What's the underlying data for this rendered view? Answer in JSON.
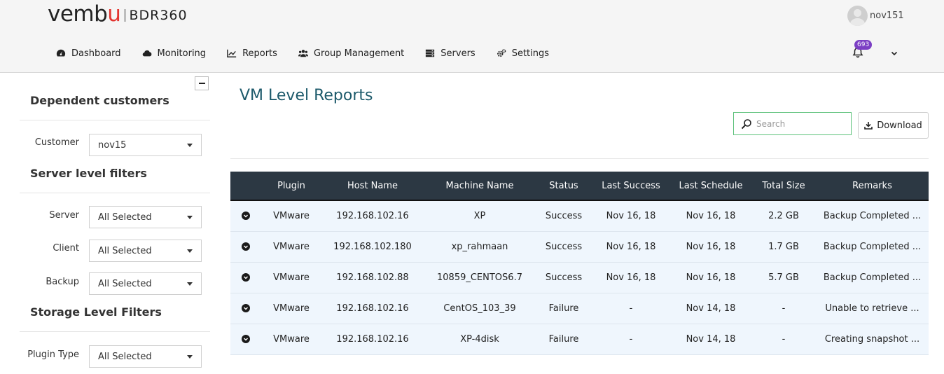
{
  "brand": {
    "word_start": "vemb",
    "word_u": "u",
    "product": "BDR360"
  },
  "user": {
    "name": "nov151"
  },
  "nav": [
    {
      "label": "Dashboard",
      "icon": "dashboard-icon"
    },
    {
      "label": "Monitoring",
      "icon": "cloud-icon"
    },
    {
      "label": "Reports",
      "icon": "line-chart-icon"
    },
    {
      "label": "Group Management",
      "icon": "users-icon"
    },
    {
      "label": "Servers",
      "icon": "server-icon"
    },
    {
      "label": "Settings",
      "icon": "cogs-icon"
    }
  ],
  "notifications": {
    "count": "693"
  },
  "sidebar": {
    "section1_title": "Dependent customers",
    "customer_label": "Customer",
    "customer_value": "nov15",
    "section2_title": "Server level filters",
    "server_label": "Server",
    "server_value": "All Selected",
    "client_label": "Client",
    "client_value": "All Selected",
    "backup_label": "Backup",
    "backup_value": "All Selected",
    "section3_title": "Storage Level Filters",
    "plugin_label": "Plugin Type",
    "plugin_value": "All Selected"
  },
  "main": {
    "title": "VM Level Reports",
    "search_placeholder": "Search",
    "download_label": "Download"
  },
  "table": {
    "headers": [
      "",
      "Plugin",
      "Host Name",
      "Machine Name",
      "Status",
      "Last Success",
      "Last Schedule",
      "Total Size",
      "Remarks"
    ],
    "rows": [
      [
        "VMware",
        "192.168.102.16",
        "XP",
        "Success",
        "Nov 16, 18",
        "Nov 16, 18",
        "2.2 GB",
        "Backup Completed ..."
      ],
      [
        "VMware",
        "192.168.102.180",
        "xp_rahmaan",
        "Success",
        "Nov 16, 18",
        "Nov 16, 18",
        "1.7 GB",
        "Backup Completed ..."
      ],
      [
        "VMware",
        "192.168.102.88",
        "10859_CENTOS6.7",
        "Success",
        "Nov 16, 18",
        "Nov 16, 18",
        "5.7 GB",
        "Backup Completed ..."
      ],
      [
        "VMware",
        "192.168.102.16",
        "CentOS_103_39",
        "Failure",
        "-",
        "Nov 14, 18",
        "-",
        "Unable to retrieve ..."
      ],
      [
        "VMware",
        "192.168.102.16",
        "XP-4disk",
        "Failure",
        "-",
        "Nov 14, 18",
        "-",
        "Creating snapshot ..."
      ]
    ]
  }
}
